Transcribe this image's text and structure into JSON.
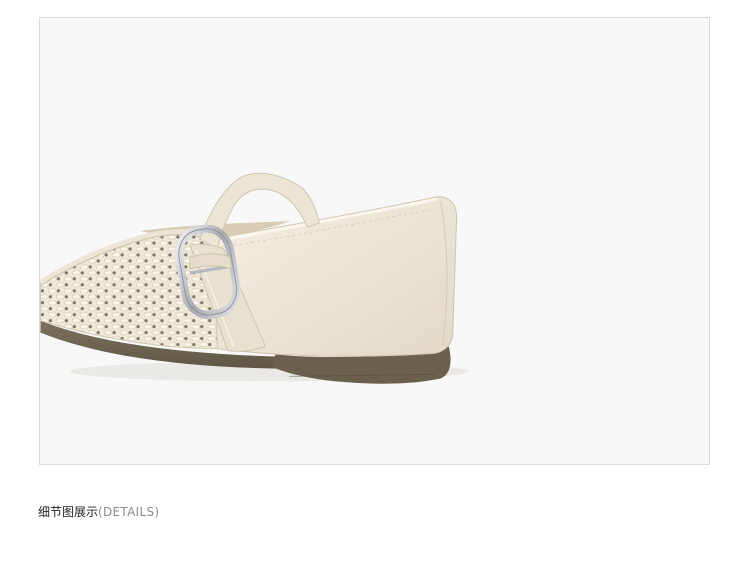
{
  "detail_section": {
    "caption_cn": "细节图展示",
    "caption_en": "(DETAILS)"
  },
  "photo": {
    "subject": "shoe-detail-photo",
    "background_color": "#f8f8f8",
    "shoe_color": "#ece5d6",
    "sole_color": "#6f6552",
    "buckle_color": "#c9ccd1"
  }
}
